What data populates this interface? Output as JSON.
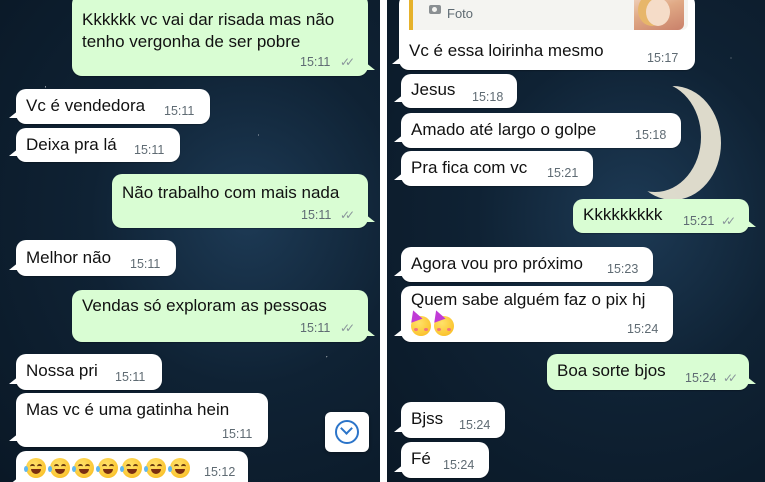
{
  "left": {
    "messages": [
      {
        "dir": "out",
        "text_lines": [
          "Kkkkkk vc vai dar risada mas não",
          "tenho vergonha de ser pobre"
        ],
        "time": "15:11",
        "ticks": "✓✓"
      },
      {
        "dir": "in",
        "text": "Vc é vendedora",
        "time": "15:11"
      },
      {
        "dir": "in",
        "text": "Deixa pra lá",
        "time": "15:11"
      },
      {
        "dir": "out",
        "text": "Não trabalho com mais nada",
        "time": "15:11",
        "ticks": "✓✓"
      },
      {
        "dir": "in",
        "text": "Melhor não",
        "time": "15:11"
      },
      {
        "dir": "out",
        "text": "Vendas só exploram as pessoas",
        "time": "15:11",
        "ticks": "✓✓"
      },
      {
        "dir": "in",
        "text": "Nossa pri",
        "time": "15:11"
      },
      {
        "dir": "in",
        "text": "Mas vc é uma gatinha hein",
        "time": "15:11"
      },
      {
        "dir": "in",
        "emoji": "😂😂😂😂😂😂😂",
        "time": "15:12"
      }
    ],
    "scroll_button_icon": "chevron-down-circle-icon"
  },
  "right": {
    "reply": {
      "label": "Foto",
      "icon": "camera-icon"
    },
    "messages": [
      {
        "dir": "in",
        "text": "Vc é essa loirinha mesmo",
        "time": "15:17"
      },
      {
        "dir": "in",
        "text": "Jesus",
        "time": "15:18"
      },
      {
        "dir": "in",
        "text": "Amado até largo o golpe",
        "time": "15:18"
      },
      {
        "dir": "in",
        "text": "Pra fica com vc",
        "time": "15:21"
      },
      {
        "dir": "out",
        "text": "Kkkkkkkkk",
        "time": "15:21",
        "ticks": "✓✓"
      },
      {
        "dir": "in",
        "text": "Agora vou pro próximo",
        "time": "15:23"
      },
      {
        "dir": "in",
        "text": "Quem sabe alguém faz o pix hj",
        "emoji": "🥳🥳",
        "time": "15:24"
      },
      {
        "dir": "out",
        "text": "Boa sorte bjos",
        "time": "15:24",
        "ticks": "✓✓"
      },
      {
        "dir": "in",
        "text": "Bjss",
        "time": "15:24"
      },
      {
        "dir": "in",
        "text": "Fé",
        "time": "15:24"
      }
    ]
  },
  "colors": {
    "outgoing_bubble": "#d9fdd3",
    "incoming_bubble": "#ffffff",
    "wallpaper": "#0f2234",
    "reply_accent": "#e6b22b"
  }
}
